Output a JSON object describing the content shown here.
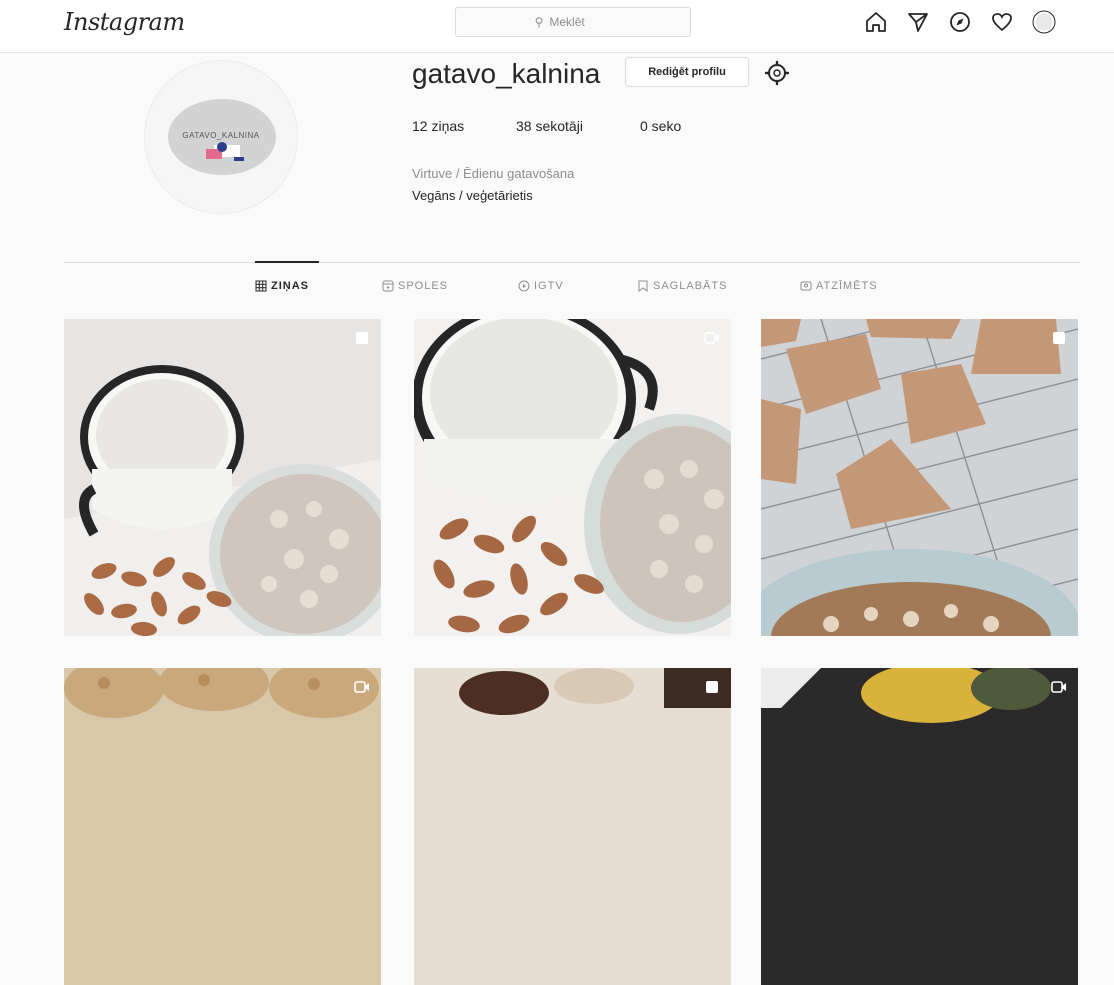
{
  "header": {
    "logo": "Instagram",
    "search_placeholder": "Meklēt",
    "nav_icons": [
      "home-icon",
      "direct-icon",
      "explore-icon",
      "activity-icon",
      "profile-avatar"
    ]
  },
  "profile": {
    "username": "gatavo_kalnina",
    "edit_button": "Rediģēt profilu",
    "stats": [
      "12 ziņas",
      "38 sekotāji",
      "0 seko"
    ],
    "category": "Virtuve / Ēdienu gatavošana",
    "bio": "Vegāns / veģetārietis",
    "avatar_text": "GATAVO_KALNINA"
  },
  "tabs": [
    {
      "label": "ZIŅAS",
      "icon": "grid-icon",
      "active": true
    },
    {
      "label": "SPOLES",
      "icon": "reels-icon",
      "active": false
    },
    {
      "label": "IGTV",
      "icon": "igtv-icon",
      "active": false
    },
    {
      "label": "SAGLABĀTS",
      "icon": "bookmark-icon",
      "active": false
    },
    {
      "label": "ATZĪMĒTS",
      "icon": "tagged-icon",
      "active": false
    }
  ],
  "posts": [
    {
      "badge": "carousel-icon",
      "subject": "milk-oats-almonds"
    },
    {
      "badge": "video-icon",
      "subject": "milk-oats-almonds-closeup"
    },
    {
      "badge": "carousel-icon",
      "subject": "cookies-on-rack"
    },
    {
      "badge": "video-icon",
      "subject": "cookies-tray"
    },
    {
      "badge": "carousel-icon",
      "subject": "chocolate-dessert"
    },
    {
      "badge": "video-icon",
      "subject": "dark-food"
    }
  ],
  "colors": {
    "background": "#fafafa",
    "border": "#dbdbdb",
    "text": "#262626",
    "muted": "#8e8e8e"
  }
}
